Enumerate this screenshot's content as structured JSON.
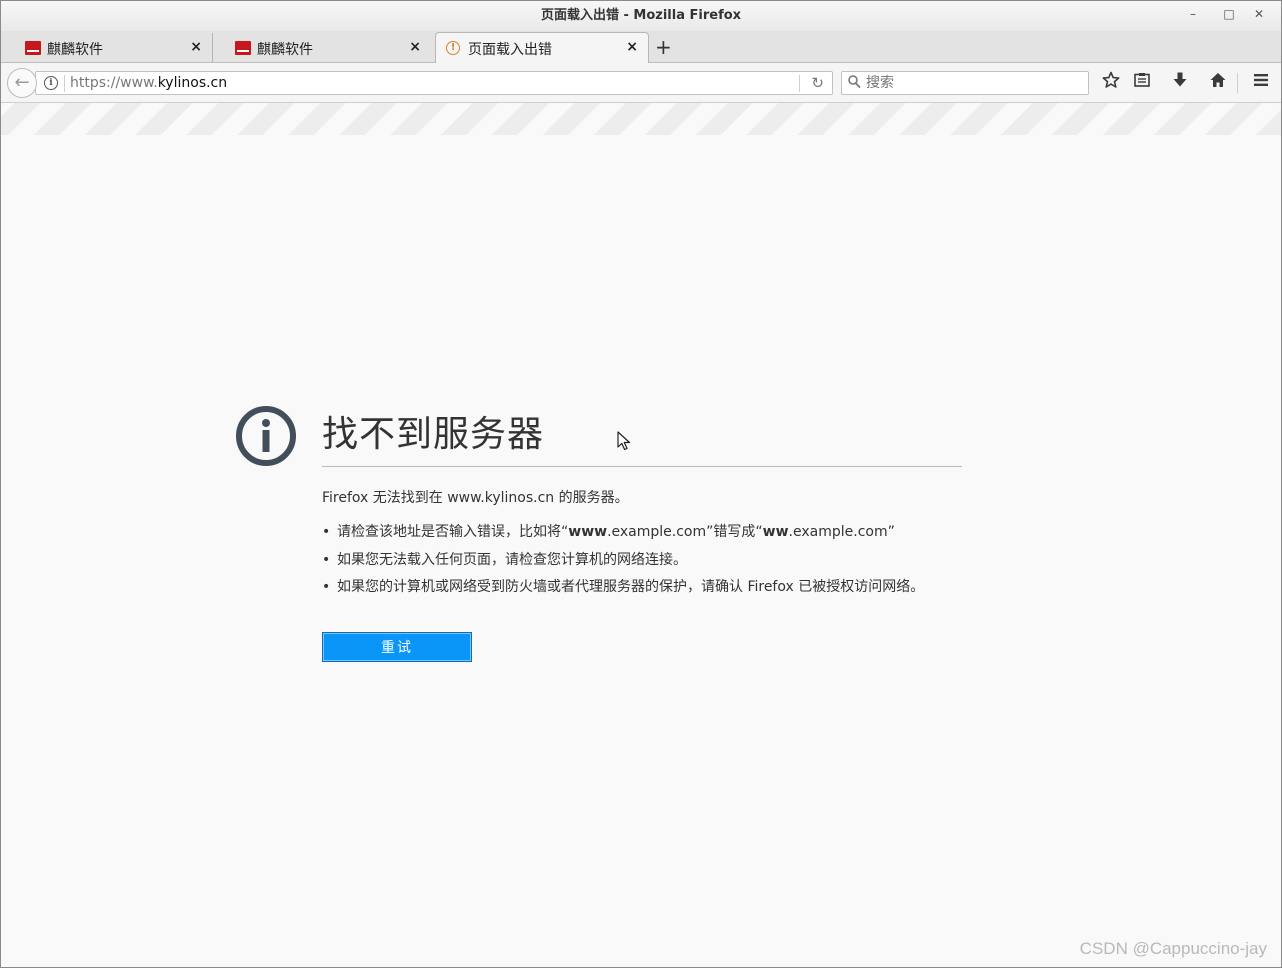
{
  "window": {
    "title": "页面载入出错 - Mozilla Firefox",
    "controls": {
      "minimize": "–",
      "maximize": "□",
      "close": "✕"
    }
  },
  "tabs": [
    {
      "label": "麒麟软件",
      "icon": "kylin-logo-icon",
      "close": "×"
    },
    {
      "label": "麒麟软件",
      "icon": "kylin-logo-icon",
      "close": "×"
    },
    {
      "label": "页面载入出错",
      "icon": "warning-icon",
      "warn": "!",
      "close": "×",
      "active": true
    }
  ],
  "new_tab": "+",
  "nav": {
    "back": "←",
    "url_prefix": "https://www.",
    "url_domain": "kylinos.cn",
    "reload": "↻",
    "search_placeholder": "搜索",
    "search_icon": "⚲",
    "toolbar_icons": [
      "star-icon",
      "reading-list-icon",
      "download-icon",
      "home-icon",
      "menu-icon"
    ],
    "toolbar_glyphs": {
      "star": "☆",
      "library": "▤",
      "download": "⬇",
      "home": "⌂",
      "menu": "☰"
    }
  },
  "error": {
    "title": "找不到服务器",
    "description": "Firefox 无法找到在 www.kylinos.cn 的服务器。",
    "items": [
      {
        "pre": "请检查该地址是否输入错误，比如将“",
        "b1": "www",
        "mid1": ".example.com”错写成“",
        "b2": "ww",
        "post": ".example.com”"
      },
      {
        "text": "如果您无法载入任何页面，请检查您计算机的网络连接。"
      },
      {
        "text": "如果您的计算机或网络受到防火墙或者代理服务器的保护，请确认 Firefox 已被授权访问网络。"
      }
    ],
    "retry_label": "重试"
  },
  "watermark": "CSDN @Cappuccino-jay",
  "colors": {
    "accent": "#0996f8",
    "error_icon": "#424f5a",
    "warning": "#d7812b",
    "kylin_red": "#c8161d"
  }
}
